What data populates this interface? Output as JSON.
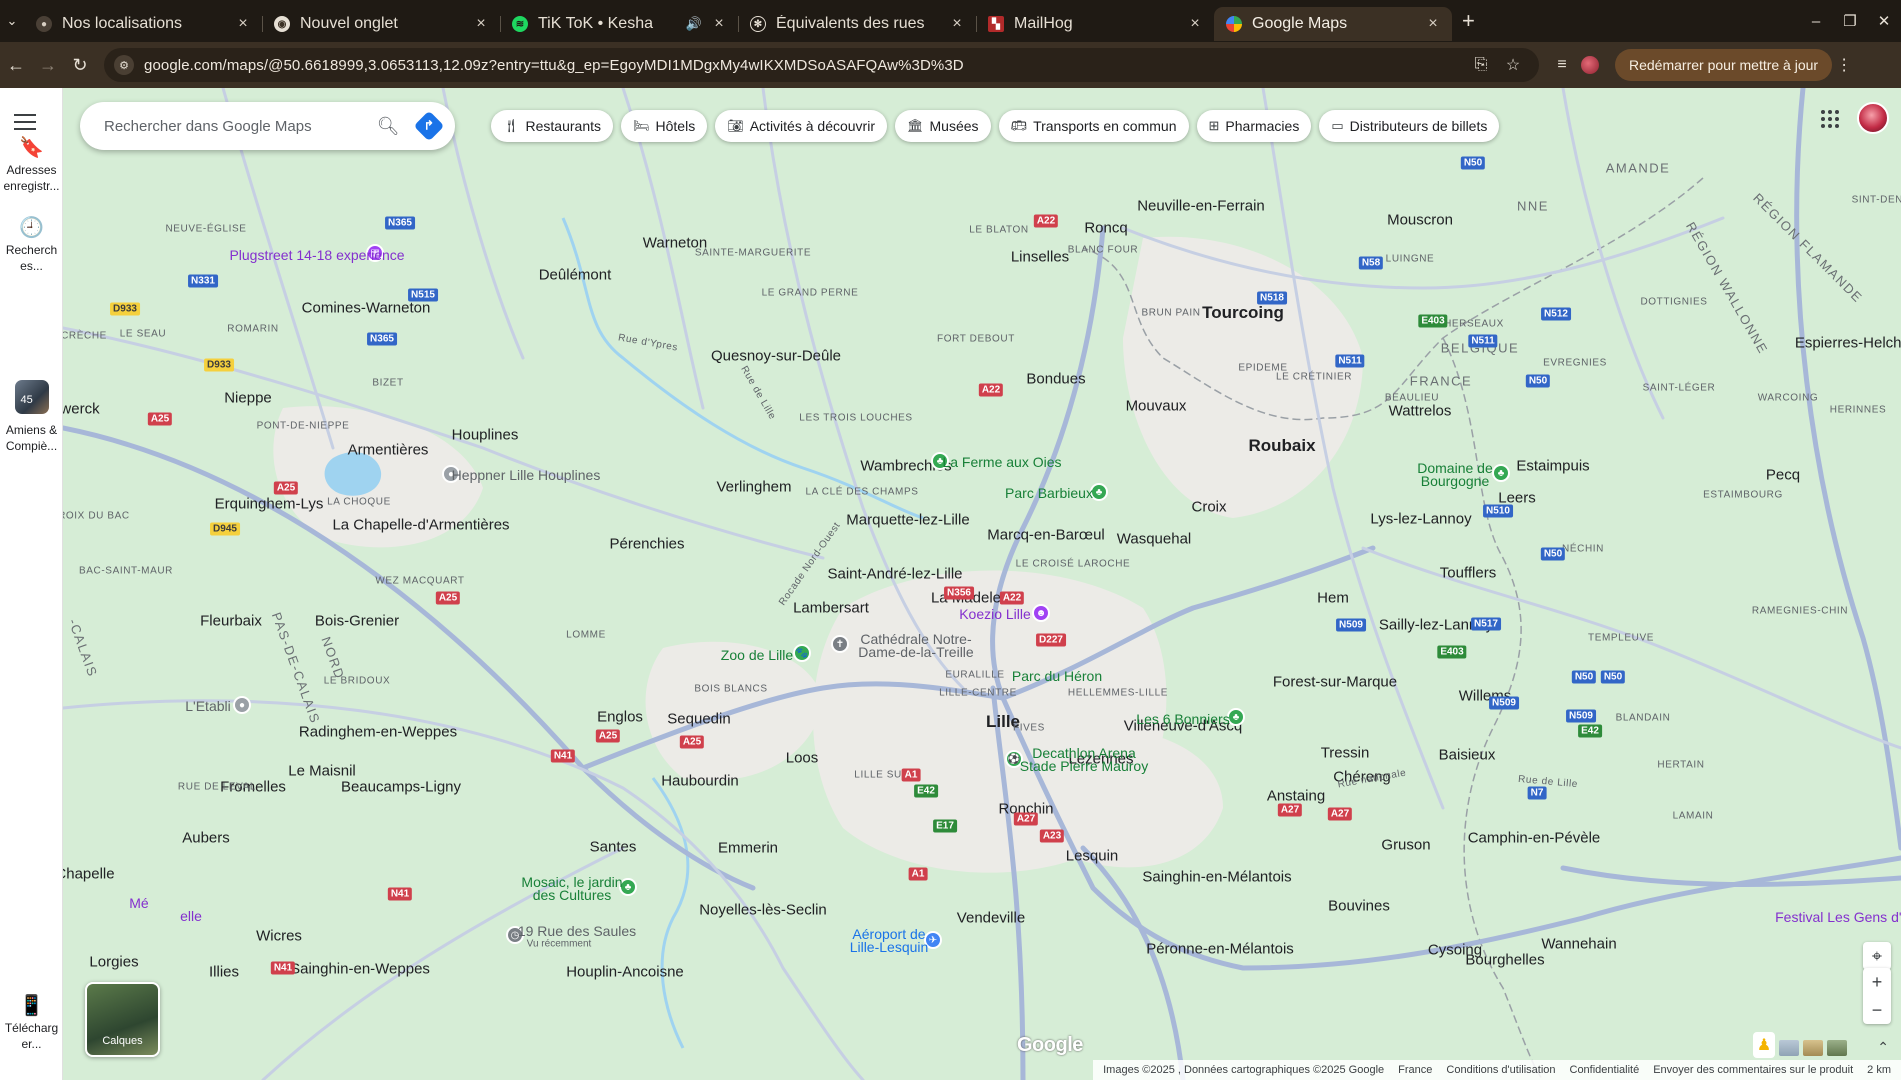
{
  "browser": {
    "tabs": [
      {
        "title": "Nos localisations",
        "favicon": "site-icon",
        "active": false
      },
      {
        "title": "Nouvel onglet",
        "favicon": "chrome-icon",
        "active": false
      },
      {
        "title": "TiK ToK • Kesha",
        "favicon": "spotify-icon",
        "active": false,
        "audio": true
      },
      {
        "title": "Équivalents des rues",
        "favicon": "openai-icon",
        "active": false
      },
      {
        "title": "MailHog",
        "favicon": "mailhog-icon",
        "active": false
      },
      {
        "title": "Google Maps",
        "favicon": "google-maps-icon",
        "active": true
      }
    ],
    "url": "google.com/maps/@50.6618999,3.0653113,12.09z?entry=ttu&g_ep=EgoyMDI1MDgxMy4wIKXMDSoASAFQAw%3D%3D",
    "restart_label": "Redémarrer pour mettre à jour"
  },
  "rail": {
    "saved_label": "Adresses enregistr...",
    "recent_label": "Recherch es...",
    "recent_place_label": "Amiens & Compiè...",
    "recent_place_badge": "45",
    "download_label": "Télécharg er..."
  },
  "search": {
    "placeholder": "Rechercher dans Google Maps"
  },
  "chips": [
    {
      "label": "Restaurants",
      "icon": "fork-knife-icon"
    },
    {
      "label": "Hôtels",
      "icon": "bed-icon"
    },
    {
      "label": "Activités à découvrir",
      "icon": "camera-icon"
    },
    {
      "label": "Musées",
      "icon": "museum-icon"
    },
    {
      "label": "Transports en commun",
      "icon": "bus-icon"
    },
    {
      "label": "Pharmacies",
      "icon": "pharmacy-icon"
    },
    {
      "label": "Distributeurs de billets",
      "icon": "atm-icon"
    }
  ],
  "map": {
    "layers_label": "Calques",
    "footer": {
      "imagery": "Images ©2025 , Données cartographiques ©2025 Google",
      "country": "France",
      "terms": "Conditions d'utilisation",
      "privacy": "Confidentialité",
      "feedback": "Envoyer des commentaires sur le produit",
      "scale": "2 km"
    },
    "logo": "Google",
    "places": [
      {
        "name": "Tourcoing",
        "kind": "big"
      },
      {
        "name": "Roubaix",
        "kind": "big"
      },
      {
        "name": "Lille",
        "kind": "big"
      },
      {
        "name": "Mouscron",
        "kind": "mid"
      },
      {
        "name": "Warneton",
        "kind": "mid"
      },
      {
        "name": "Linselles",
        "kind": "mid"
      },
      {
        "name": "Roncq",
        "kind": "mid"
      },
      {
        "name": "Neuville-en-Ferrain",
        "kind": "mid"
      },
      {
        "name": "Deûlémont",
        "kind": "mid"
      },
      {
        "name": "Comines-Warneton",
        "kind": "mid"
      },
      {
        "name": "Quesnoy-sur-Deûle",
        "kind": "mid"
      },
      {
        "name": "Bondues",
        "kind": "mid"
      },
      {
        "name": "Mouvaux",
        "kind": "mid"
      },
      {
        "name": "Wattrelos",
        "kind": "mid"
      },
      {
        "name": "Nieppe",
        "kind": "mid"
      },
      {
        "name": "Armentières",
        "kind": "mid"
      },
      {
        "name": "Houplines",
        "kind": "mid"
      },
      {
        "name": "Wambrechies",
        "kind": "mid"
      },
      {
        "name": "Erquinghem-Lys",
        "kind": "mid"
      },
      {
        "name": "Verlinghem",
        "kind": "mid"
      },
      {
        "name": "La Chapelle-d'Armentières",
        "kind": "mid"
      },
      {
        "name": "Marquette-lez-Lille",
        "kind": "mid"
      },
      {
        "name": "Marcq-en-Barœul",
        "kind": "mid"
      },
      {
        "name": "Wasquehal",
        "kind": "mid"
      },
      {
        "name": "Croix",
        "kind": "mid"
      },
      {
        "name": "Lys-lez-Lannoy",
        "kind": "mid"
      },
      {
        "name": "Leers",
        "kind": "mid"
      },
      {
        "name": "Estaimpuis",
        "kind": "mid"
      },
      {
        "name": "Pérenchies",
        "kind": "mid"
      },
      {
        "name": "Saint-André-lez-Lille",
        "kind": "mid"
      },
      {
        "name": "Lambersart",
        "kind": "mid"
      },
      {
        "name": "La Madeleine",
        "kind": "mid"
      },
      {
        "name": "Hem",
        "kind": "mid"
      },
      {
        "name": "Toufflers",
        "kind": "mid"
      },
      {
        "name": "Sailly-lez-Lannoy",
        "kind": "mid"
      },
      {
        "name": "Fleurbaix",
        "kind": "mid"
      },
      {
        "name": "Bois-Grenier",
        "kind": "mid"
      },
      {
        "name": "Forest-sur-Marque",
        "kind": "mid"
      },
      {
        "name": "Willems",
        "kind": "mid"
      },
      {
        "name": "Englos",
        "kind": "mid"
      },
      {
        "name": "Sequedin",
        "kind": "mid"
      },
      {
        "name": "Radinghem-en-Weppes",
        "kind": "mid"
      },
      {
        "name": "Villeneuve-d'Ascq",
        "kind": "mid"
      },
      {
        "name": "Le Maisnil",
        "kind": "mid"
      },
      {
        "name": "Loos",
        "kind": "mid"
      },
      {
        "name": "Lezennes",
        "kind": "mid"
      },
      {
        "name": "Tressin",
        "kind": "mid"
      },
      {
        "name": "Baisieux",
        "kind": "mid"
      },
      {
        "name": "Fromelles",
        "kind": "mid"
      },
      {
        "name": "Beaucamps-Ligny",
        "kind": "mid"
      },
      {
        "name": "Haubourdin",
        "kind": "mid"
      },
      {
        "name": "Chéreng",
        "kind": "mid"
      },
      {
        "name": "Anstaing",
        "kind": "mid"
      },
      {
        "name": "Ronchin",
        "kind": "mid"
      },
      {
        "name": "Aubers",
        "kind": "mid"
      },
      {
        "name": "Camphin-en-Pévèle",
        "kind": "mid"
      },
      {
        "name": "Gruson",
        "kind": "mid"
      },
      {
        "name": "Santes",
        "kind": "mid"
      },
      {
        "name": "Emmerin",
        "kind": "mid"
      },
      {
        "name": "Lesquin",
        "kind": "mid"
      },
      {
        "name": "Sainghin-en-Mélantois",
        "kind": "mid"
      },
      {
        "name": "Bouvines",
        "kind": "mid"
      },
      {
        "name": "Noyelles-lès-Seclin",
        "kind": "mid"
      },
      {
        "name": "Vendeville",
        "kind": "mid"
      },
      {
        "name": "Péronne-en-Mélantois",
        "kind": "mid"
      },
      {
        "name": "Cysoing",
        "kind": "mid"
      },
      {
        "name": "Bourghelles",
        "kind": "mid"
      },
      {
        "name": "Wannehain",
        "kind": "mid"
      },
      {
        "name": "Wicres",
        "kind": "mid"
      },
      {
        "name": "Sainghin-en-Weppes",
        "kind": "mid"
      },
      {
        "name": "Houplin-Ancoisne",
        "kind": "mid"
      },
      {
        "name": "Illies",
        "kind": "mid"
      },
      {
        "name": "Lorgies",
        "kind": "mid"
      },
      {
        "name": "Chapelle",
        "kind": "mid"
      },
      {
        "name": "Pecq",
        "kind": "mid"
      },
      {
        "name": "Espierres-Helchin",
        "kind": "mid"
      },
      {
        "name": "werck",
        "kind": "mid"
      },
      {
        "name": "NEUVE-ÉGLISE",
        "kind": "small"
      },
      {
        "name": "SAINTE-MARGUERITE",
        "kind": "small"
      },
      {
        "name": "LE BLATON",
        "kind": "small"
      },
      {
        "name": "BLANC FOUR",
        "kind": "small"
      },
      {
        "name": "LUINGNE",
        "kind": "small"
      },
      {
        "name": "DOTTIGNIES",
        "kind": "small"
      },
      {
        "name": "HERSEAUX",
        "kind": "small"
      },
      {
        "name": "BRUN PAIN",
        "kind": "small"
      },
      {
        "name": "LE GRAND PERNE",
        "kind": "small"
      },
      {
        "name": "ROMARIN",
        "kind": "small"
      },
      {
        "name": "CRÈCHE",
        "kind": "small"
      },
      {
        "name": "LE SEAU",
        "kind": "small"
      },
      {
        "name": "FORT DEBOUT",
        "kind": "small"
      },
      {
        "name": "EPIDEME",
        "kind": "small"
      },
      {
        "name": "LE CRÉTINIER",
        "kind": "small"
      },
      {
        "name": "EVREGNIES",
        "kind": "small"
      },
      {
        "name": "SAINT-LÉGER",
        "kind": "small"
      },
      {
        "name": "WARCOING",
        "kind": "small"
      },
      {
        "name": "HERINNES",
        "kind": "small"
      },
      {
        "name": "BIZET",
        "kind": "small"
      },
      {
        "name": "PONT-DE-NIEPPE",
        "kind": "small"
      },
      {
        "name": "LES TROIS LOUCHES",
        "kind": "small"
      },
      {
        "name": "BEAULIEU",
        "kind": "small"
      },
      {
        "name": "LA CHOQUE",
        "kind": "small"
      },
      {
        "name": "LA CLÉ DES CHAMPS",
        "kind": "small"
      },
      {
        "name": "CROIX DU BAC",
        "kind": "small"
      },
      {
        "name": "ESTAIMBOURG",
        "kind": "small"
      },
      {
        "name": "NÉCHIN",
        "kind": "small"
      },
      {
        "name": "BAC-SAINT-MAUR",
        "kind": "small"
      },
      {
        "name": "WEZ MACQUART",
        "kind": "small"
      },
      {
        "name": "LE CROISÉ LAROCHE",
        "kind": "small"
      },
      {
        "name": "RAMEGNIES-CHIN",
        "kind": "small"
      },
      {
        "name": "TEMPLEUVE",
        "kind": "small"
      },
      {
        "name": "LOMME",
        "kind": "small"
      },
      {
        "name": "EURALILLE",
        "kind": "small"
      },
      {
        "name": "LE BRIDOUX",
        "kind": "small"
      },
      {
        "name": "BOIS BLANCS",
        "kind": "small"
      },
      {
        "name": "LILLE-CENTRE",
        "kind": "small"
      },
      {
        "name": "HELLEMMES-LILLE",
        "kind": "small"
      },
      {
        "name": "BLANDAIN",
        "kind": "small"
      },
      {
        "name": "FIVES",
        "kind": "small"
      },
      {
        "name": "RUE DE LEVAL",
        "kind": "small"
      },
      {
        "name": "LILLE SUD",
        "kind": "small"
      },
      {
        "name": "HERTAIN",
        "kind": "small"
      },
      {
        "name": "LAMAIN",
        "kind": "small"
      },
      {
        "name": "BELGIQUE",
        "kind": "region"
      },
      {
        "name": "FRANCE",
        "kind": "region"
      },
      {
        "name": "RÉGION FLAMANDE",
        "kind": "region"
      },
      {
        "name": "RÉGION WALLONNE",
        "kind": "region"
      },
      {
        "name": "NORD",
        "kind": "region"
      },
      {
        "name": "PAS-DE-CALAIS",
        "kind": "region"
      },
      {
        "name": "-CALAIS",
        "kind": "region"
      },
      {
        "name": "AMANDE",
        "kind": "region"
      },
      {
        "name": "NNE",
        "kind": "region"
      },
      {
        "name": "SINT-DENI",
        "kind": "region"
      },
      {
        "name": "Rue d'Ypres",
        "kind": "street"
      },
      {
        "name": "Rue de Lille",
        "kind": "street"
      },
      {
        "name": "Rocade Nord-Ouest",
        "kind": "street"
      },
      {
        "name": "Rue nationale",
        "kind": "street"
      },
      {
        "name": "Rue de Lille",
        "kind": "street"
      }
    ],
    "pois": [
      {
        "name": "Plugstreet 14-18 experience",
        "kind": "poi-purple"
      },
      {
        "name": "Heppner Lille Houplines",
        "kind": "poi-gray"
      },
      {
        "name": "La Ferme aux Oies",
        "kind": "poi-green"
      },
      {
        "name": "Parc Barbieux",
        "kind": "poi-green"
      },
      {
        "name": "Domaine de Bourgogne",
        "kind": "poi-green"
      },
      {
        "name": "Koezio Lille",
        "kind": "poi-purple"
      },
      {
        "name": "Cathédrale Notre-Dame-de-la-Treille",
        "kind": "poi-gray"
      },
      {
        "name": "Zoo de Lille",
        "kind": "poi-green"
      },
      {
        "name": "Parc du Héron",
        "kind": "poi-green"
      },
      {
        "name": "L'Etabli",
        "kind": "poi-gray"
      },
      {
        "name": "Les 6 Bonniers",
        "kind": "poi-green"
      },
      {
        "name": "Decathlon Arena Stade Pierre Mauroy",
        "kind": "poi-green"
      },
      {
        "name": "Mosaic, le jardin des Cultures",
        "kind": "poi-green"
      },
      {
        "name": "19 Rue des Saules",
        "kind": "poi-gray"
      },
      {
        "name": "Vu récemment",
        "kind": "poi-gray"
      },
      {
        "name": "Aéroport de Lille-Lesquin",
        "kind": "poi-blue"
      },
      {
        "name": "Festival Les Gens d'E",
        "kind": "poi-purple"
      },
      {
        "name": "Mé",
        "kind": "poi-purple"
      },
      {
        "name": "elle",
        "kind": "poi-purple"
      }
    ],
    "roads": [
      "N365",
      "N331",
      "D933",
      "N515",
      "N365",
      "D933",
      "A22",
      "N58",
      "N518",
      "E403",
      "N512",
      "N511",
      "N511",
      "N50",
      "N50",
      "A22",
      "A25",
      "A25",
      "N50",
      "N510",
      "D945",
      "A25",
      "N356",
      "A22",
      "D227",
      "N509",
      "N517",
      "N50",
      "E403",
      "N509",
      "N509",
      "N41",
      "A25",
      "A25",
      "E42",
      "N7",
      "A1",
      "E42",
      "A27",
      "A27",
      "E17",
      "A27",
      "A23",
      "A1",
      "N41",
      "N41",
      "N50"
    ]
  }
}
